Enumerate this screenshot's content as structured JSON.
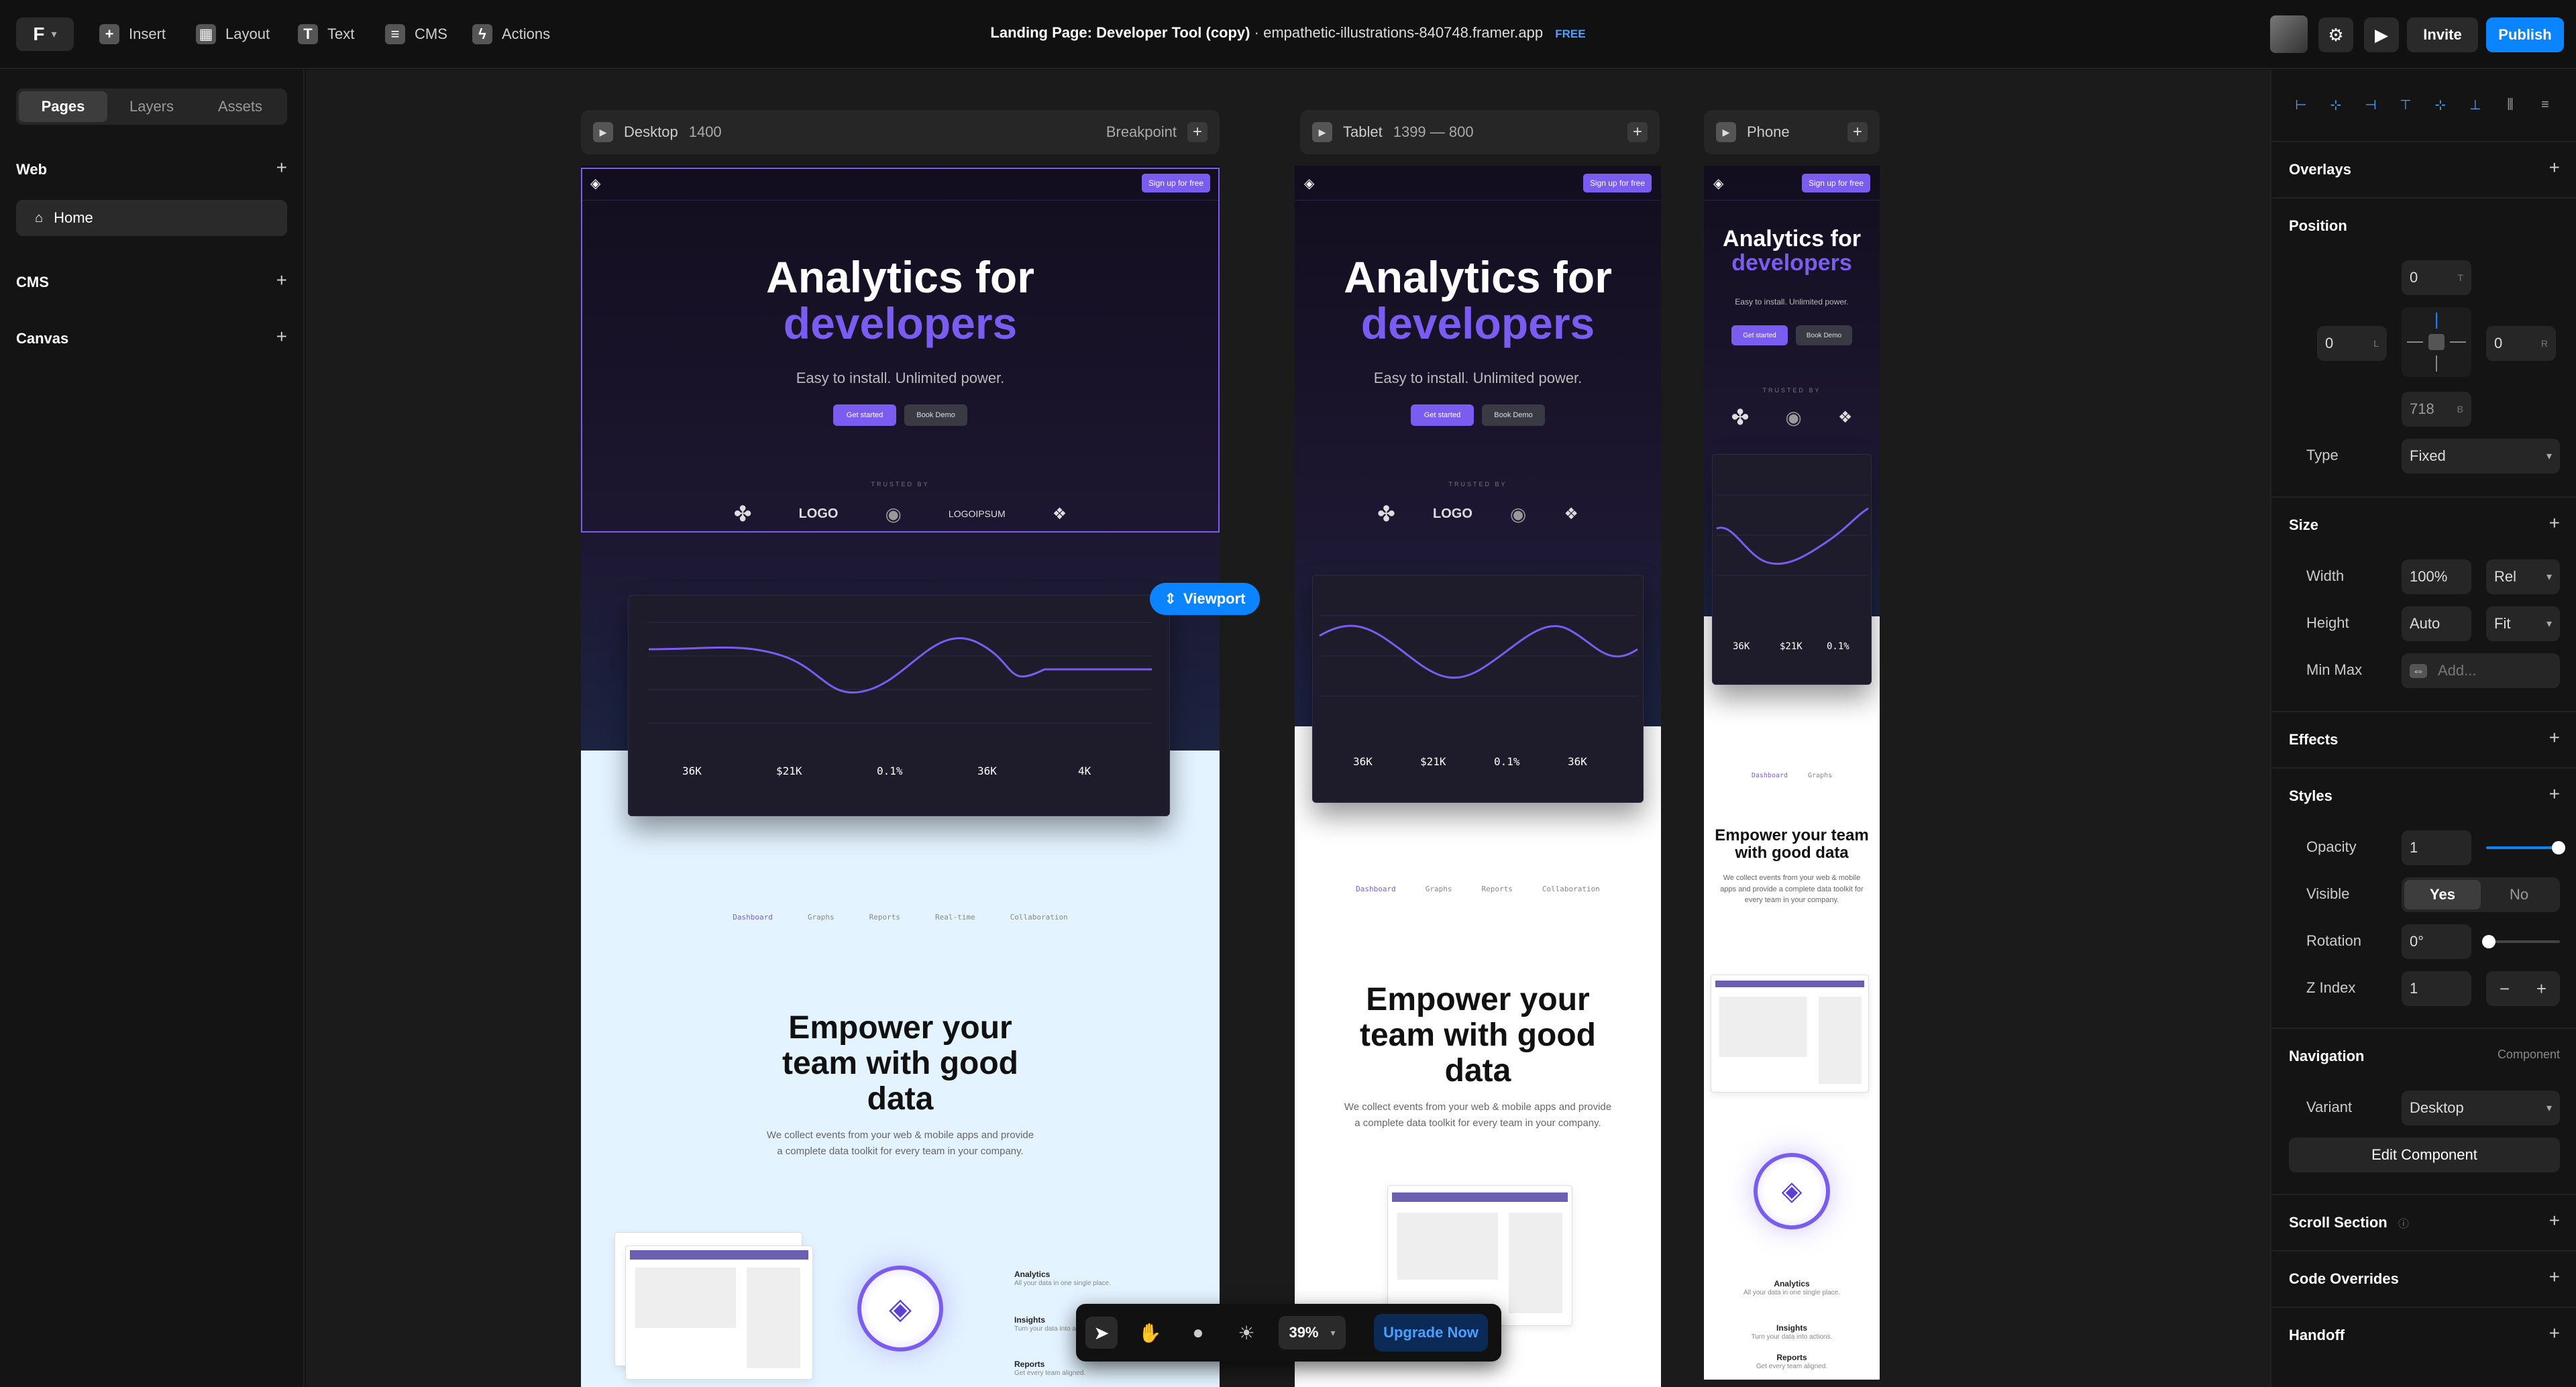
{
  "topbar": {
    "insert": "Insert",
    "layout": "Layout",
    "text": "Text",
    "cms": "CMS",
    "actions": "Actions",
    "doc_name": "Landing Page: Developer Tool (copy)",
    "doc_sep": "·",
    "doc_url": "empathetic-illustrations-840748.framer.app",
    "plan": "FREE",
    "invite": "Invite",
    "publish": "Publish"
  },
  "leftbar": {
    "tabs": [
      "Pages",
      "Layers",
      "Assets"
    ],
    "web": "Web",
    "home": "Home",
    "cms": "CMS",
    "canvas": "Canvas"
  },
  "canvas": {
    "desktop": {
      "label": "Desktop",
      "size": "1400",
      "breakpoint": "Breakpoint"
    },
    "tablet": {
      "label": "Tablet",
      "size": "1399 — 800"
    },
    "phone": {
      "label": "Phone"
    },
    "viewport_badge": "Viewport",
    "site": {
      "signup": "Sign up for free",
      "title_line1": "Analytics for",
      "title_line2": "developers",
      "subtitle": "Easy to install. Unlimited power.",
      "get_started": "Get started",
      "book_demo": "Book Demo",
      "trusted": "TRUSTED BY",
      "logo1": "LOGO",
      "logo2": "LOGOIPSUM",
      "stats": [
        "36K",
        "$21K",
        "0.1%",
        "36K",
        "4K"
      ],
      "tabs": [
        "Dashboard",
        "Graphs",
        "Reports",
        "Real-time",
        "Collaboration"
      ],
      "tabs_tablet": [
        "Dashboard",
        "Graphs",
        "Reports",
        "Collaboration"
      ],
      "tabs_phone": [
        "Dashboard",
        "Graphs"
      ],
      "empower_line1": "Empower your",
      "empower_line2": "team with good",
      "empower_line3": "data",
      "empower_tablet_1": "Empower your",
      "empower_tablet_2": "team with good",
      "empower_tablet_3": "data",
      "empower_phone_1": "Empower your team",
      "empower_phone_2": "with good data",
      "empower_sub1": "We collect events from your web & mobile apps and provide",
      "empower_sub2": "a complete data toolkit for every team in your company.",
      "features": [
        {
          "title": "Analytics",
          "desc": "All your data in one single place."
        },
        {
          "title": "Insights",
          "desc": "Turn your data into actions."
        },
        {
          "title": "Reports",
          "desc": "Get every team aligned."
        }
      ]
    },
    "toolbar": {
      "zoom": "39%",
      "upgrade": "Upgrade Now"
    }
  },
  "rightbar": {
    "overlays": "Overlays",
    "position": "Position",
    "pos_top": "0",
    "pos_top_sub": "T",
    "pos_left": "0",
    "pos_left_sub": "L",
    "pos_right": "0",
    "pos_right_sub": "R",
    "pos_bottom": "718",
    "pos_bottom_sub": "B",
    "type_label": "Type",
    "type_value": "Fixed",
    "size": "Size",
    "width_label": "Width",
    "width_value": "100%",
    "width_unit": "Rel",
    "height_label": "Height",
    "height_value": "Auto",
    "height_unit": "Fit",
    "minmax_label": "Min Max",
    "minmax_placeholder": "Add...",
    "effects": "Effects",
    "styles": "Styles",
    "opacity_label": "Opacity",
    "opacity_value": "1",
    "visible_label": "Visible",
    "visible_yes": "Yes",
    "visible_no": "No",
    "rotation_label": "Rotation",
    "rotation_value": "0°",
    "zindex_label": "Z Index",
    "zindex_value": "1",
    "navigation": "Navigation",
    "navigation_sub": "Component",
    "variant_label": "Variant",
    "variant_value": "Desktop",
    "edit_component": "Edit Component",
    "scroll_section": "Scroll Section",
    "code_overrides": "Code Overrides",
    "handoff": "Handoff"
  }
}
